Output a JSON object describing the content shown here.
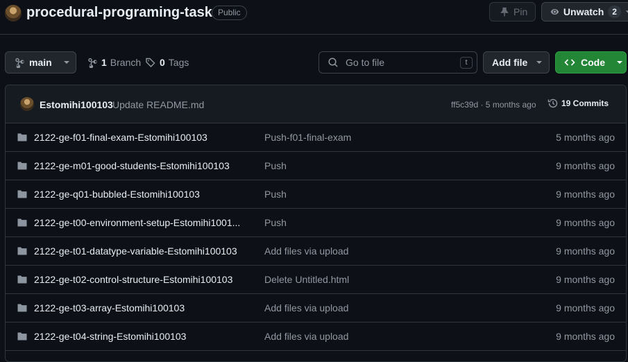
{
  "repo": {
    "name": "procedural-programing-task",
    "visibility": "Public"
  },
  "header_actions": {
    "pin_label": "Pin",
    "unwatch_label": "Unwatch",
    "watch_count": "2"
  },
  "toolbar": {
    "branch_name": "main",
    "branches_count": "1",
    "branches_label": "Branch",
    "tags_count": "0",
    "tags_label": "Tags",
    "search_placeholder": "Go to file",
    "search_shortcut": "t",
    "add_file_label": "Add file",
    "code_label": "Code"
  },
  "latest_commit": {
    "author": "Estomihi100103",
    "message": "Update README.md",
    "meta": "ff5c39d · 5 months ago",
    "commits_label": "19 Commits"
  },
  "files": [
    {
      "name": "2122-ge-f01-final-exam-Estomihi100103",
      "message": "Push-f01-final-exam",
      "date": "5 months ago"
    },
    {
      "name": "2122-ge-m01-good-students-Estomihi100103",
      "message": "Push",
      "date": "9 months ago"
    },
    {
      "name": "2122-ge-q01-bubbled-Estomihi100103",
      "message": "Push",
      "date": "9 months ago"
    },
    {
      "name": "2122-ge-t00-environment-setup-Estomihi1001...",
      "message": "Push",
      "date": "9 months ago"
    },
    {
      "name": "2122-ge-t01-datatype-variable-Estomihi100103",
      "message": "Add files via upload",
      "date": "9 months ago"
    },
    {
      "name": "2122-ge-t02-control-structure-Estomihi100103",
      "message": "Delete Untitled.html",
      "date": "9 months ago"
    },
    {
      "name": "2122-ge-t03-array-Estomihi100103",
      "message": "Add files via upload",
      "date": "9 months ago"
    },
    {
      "name": "2122-ge-t04-string-Estomihi100103",
      "message": "Add files via upload",
      "date": "9 months ago"
    }
  ]
}
